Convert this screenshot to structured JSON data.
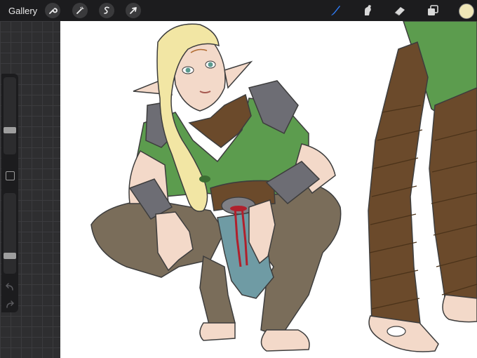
{
  "topbar": {
    "gallery_label": "Gallery",
    "left_tools": [
      "wrench-icon",
      "magic-wand-icon",
      "selection-icon",
      "transform-arrow-icon"
    ],
    "right_tools": [
      "brush-icon",
      "smudge-icon",
      "eraser-icon",
      "layers-icon"
    ],
    "active_tool": "brush-icon",
    "active_color": "#f0e7b8"
  },
  "sidebar": {
    "brush_size_level": 0.3,
    "opacity_level": 0.2
  },
  "colors": {
    "accent": "#2f7cf6",
    "skin": "#f3d9c9",
    "hair": "#f2e6a4",
    "tunic": "#5c9c4e",
    "armor": "#6d6d74",
    "leather": "#6b4a2b",
    "pants": "#7a6d5a",
    "cloth": "#6f9ba4",
    "belt": "#b0202c"
  }
}
